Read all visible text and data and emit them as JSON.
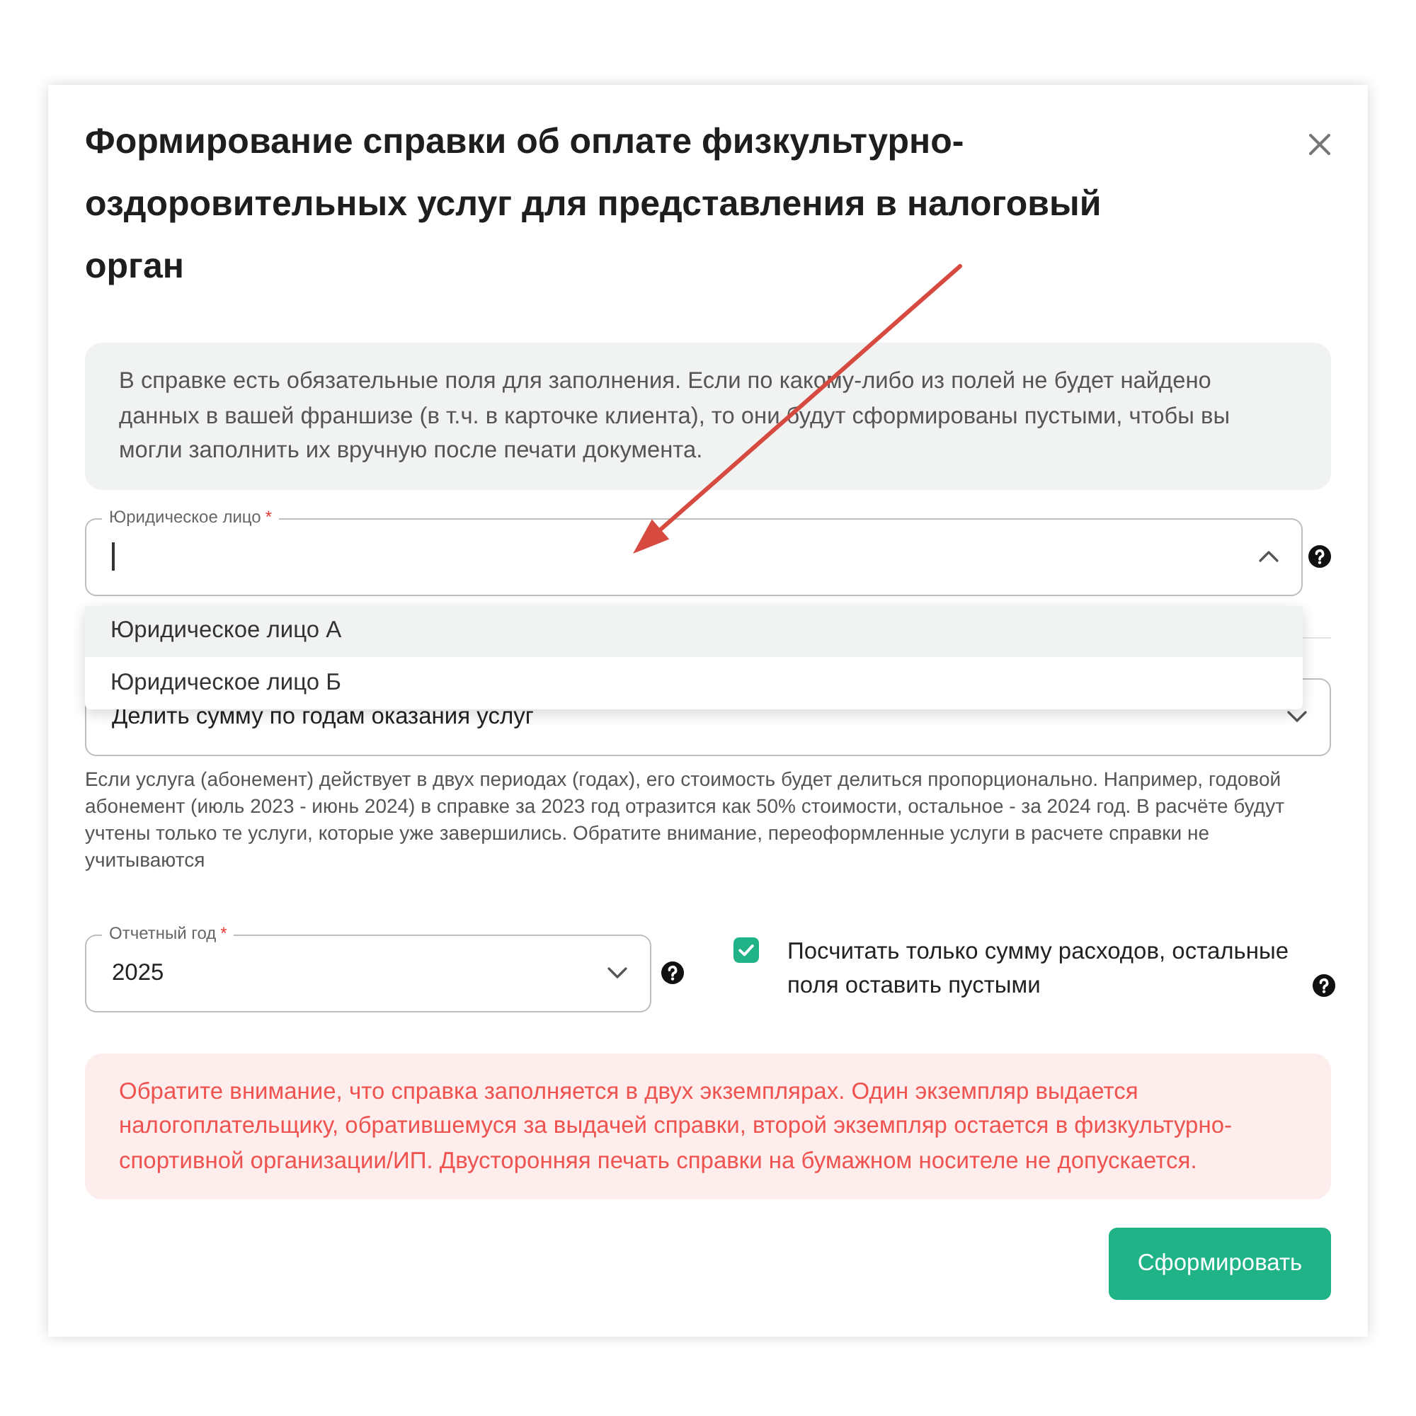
{
  "dialog": {
    "title": "Формирование справки об оплате физкультурно-оздоровительных услуг для представления в налоговый орган"
  },
  "info_notice": "В справке есть обязательные поля для заполнения. Если по какому-либо из полей не будет найдено данных в вашей франшизе (в т.ч. в карточке клиента), то они будут сформированы пустыми, чтобы вы могли заполнить их вручную после печати документа.",
  "legal_entity": {
    "label": "Юридическое лицо",
    "required_mark": "*",
    "focused": true,
    "expanded": true,
    "options": [
      {
        "label": "Юридическое лицо А",
        "selected": true
      },
      {
        "label": "Юридическое лицо Б",
        "selected": false
      }
    ]
  },
  "distribution": {
    "value": "Делить сумму по годам оказания услуг",
    "expanded": false,
    "hint": "Если услуга (абонемент) действует в двух периодах (годах), его стоимость будет делиться пропорционально. Например, годовой абонемент (июль 2023 - июнь 2024) в справке за 2023 год отразится как 50% стоимости, остальное - за 2024 год. В расчёте будут учтены только те услуги, которые уже завершились. Обратите внимание, переоформленные услуги в расчете справки не учитываются"
  },
  "year": {
    "label": "Отчетный год",
    "required_mark": "*",
    "value": "2025",
    "expanded": false
  },
  "expenses_only": {
    "label": "Посчитать только сумму расходов, остальные поля оставить пустыми",
    "checked": true
  },
  "warning_notice": "Обратите внимание, что справка заполняется в двух экземплярах. Один экземпляр выдается налогоплательщику, обратившемуся за выдачей справки, второй экземпляр остается в физкультурно-спортивной организации/ИП. Двусторонняя печать справки на бумажном носителе не допускается.",
  "submit_button": {
    "label": "Сформировать"
  }
}
